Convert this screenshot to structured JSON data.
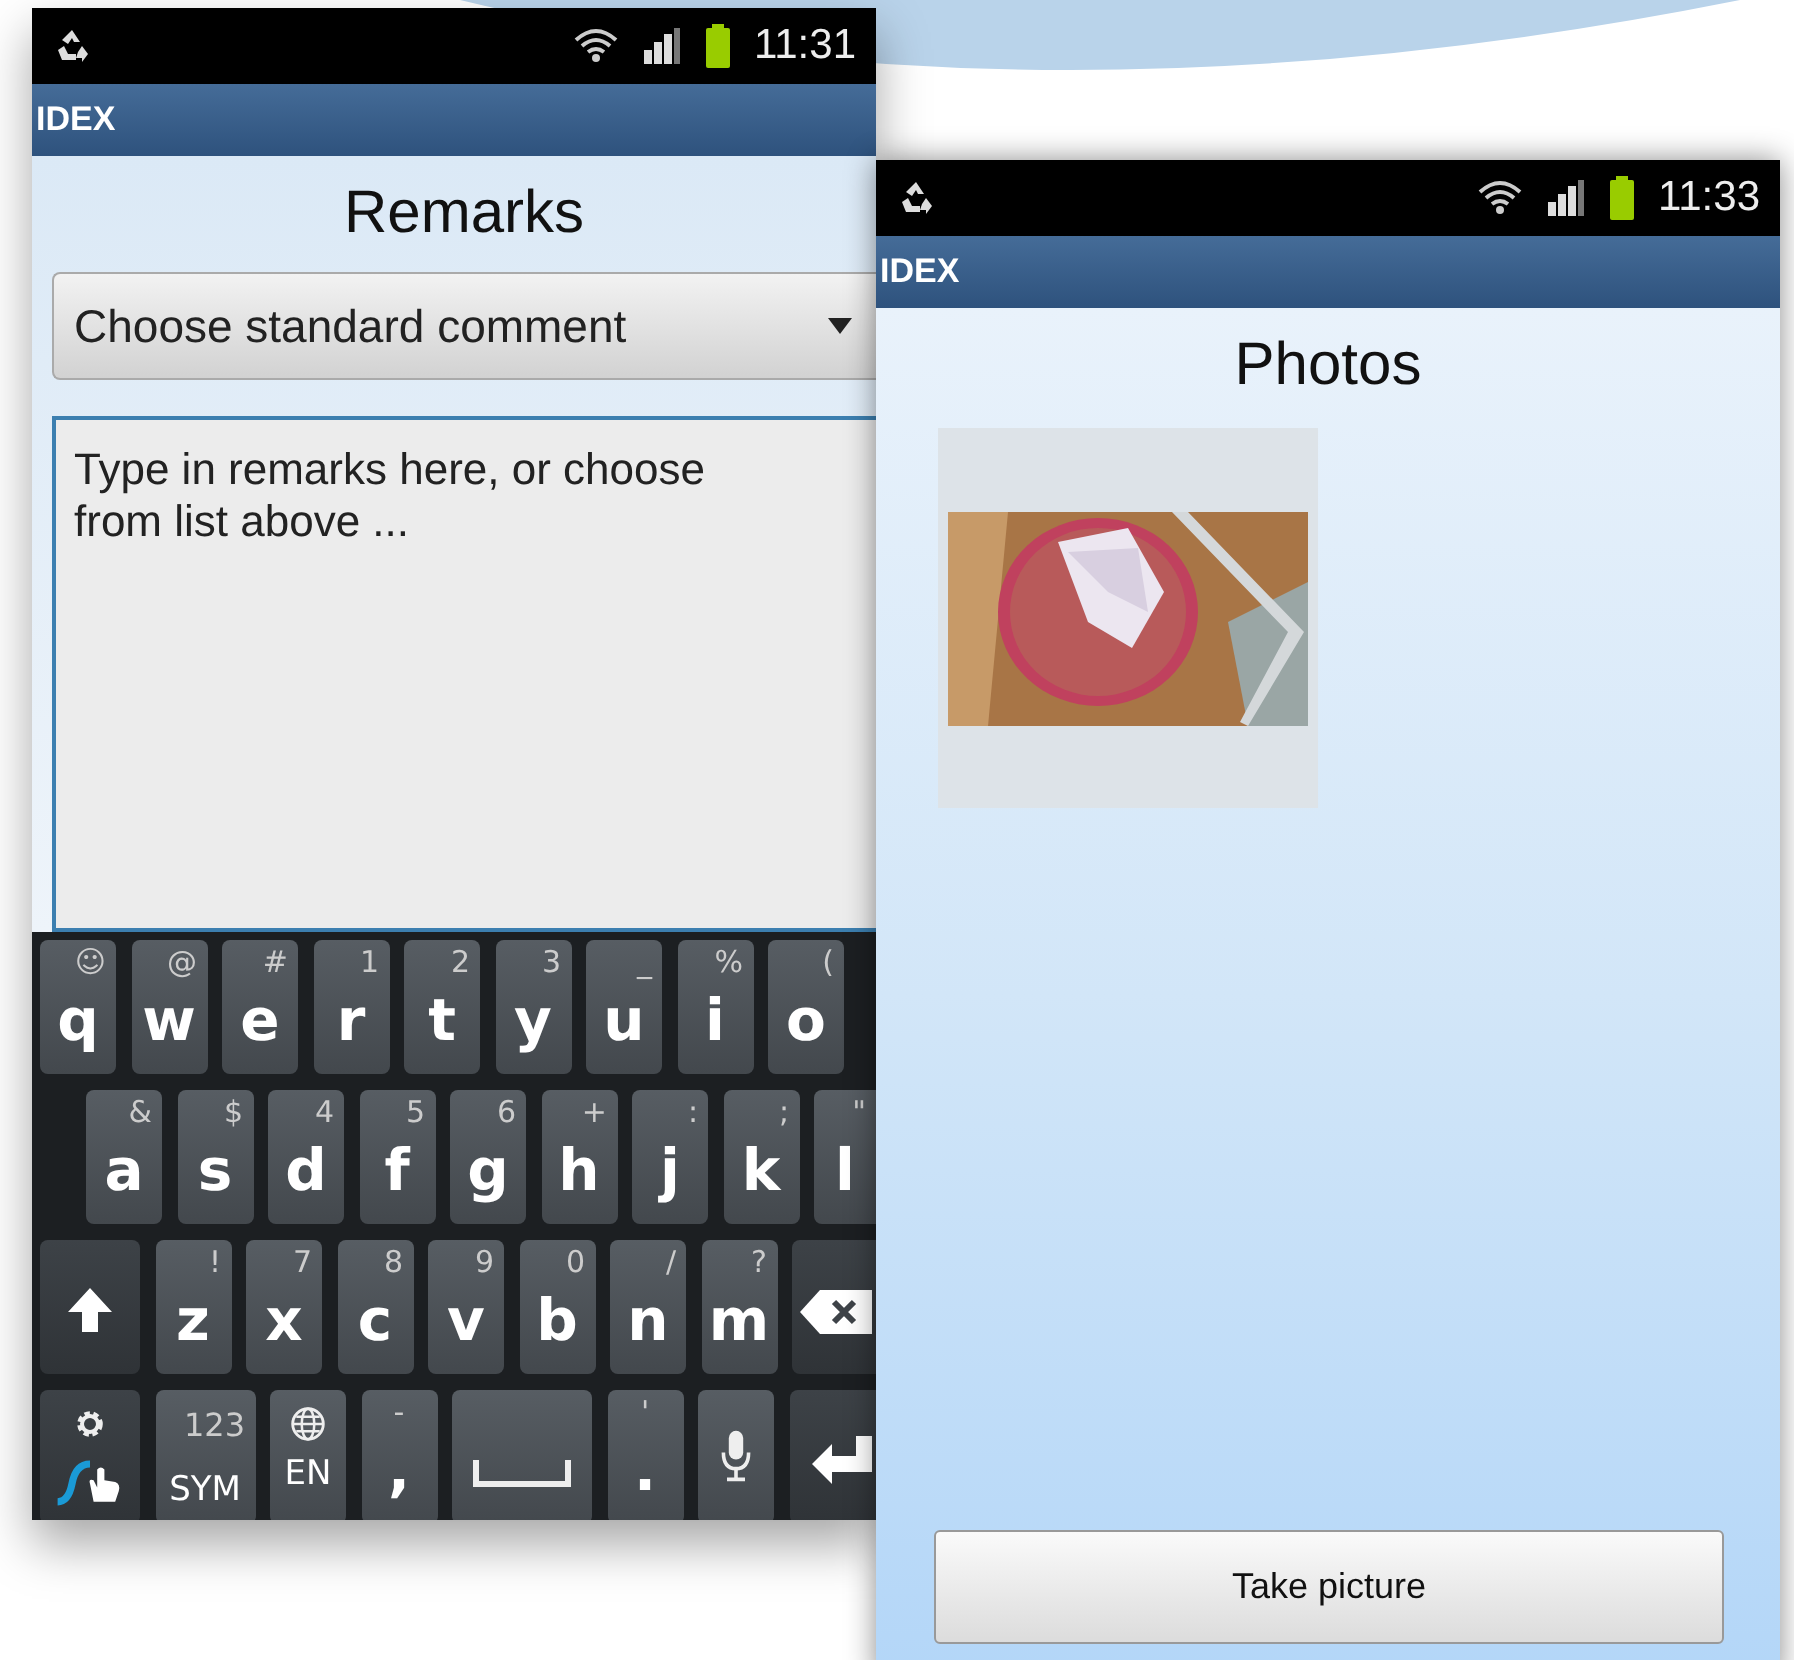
{
  "remarks_screen": {
    "status_bar": {
      "time": "11:31"
    },
    "app_bar": {
      "title": "IDEX"
    },
    "heading": "Remarks",
    "dropdown": {
      "value": "Choose standard comment"
    },
    "remarks_field": {
      "placeholder": "Type in remarks here, or choose from list above ..."
    },
    "keyboard": {
      "rows": [
        {
          "keys": [
            {
              "kind": "char",
              "hint": "☺",
              "label": "q"
            },
            {
              "kind": "char",
              "hint": "@",
              "label": "w"
            },
            {
              "kind": "char",
              "hint": "#",
              "label": "e"
            },
            {
              "kind": "char",
              "hint": "1",
              "label": "r"
            },
            {
              "kind": "char",
              "hint": "2",
              "label": "t"
            },
            {
              "kind": "char",
              "hint": "3",
              "label": "y"
            },
            {
              "kind": "char",
              "hint": "_",
              "label": "u"
            },
            {
              "kind": "char",
              "hint": "%",
              "label": "i"
            },
            {
              "kind": "char",
              "hint": "(",
              "label": "o"
            }
          ]
        },
        {
          "keys": [
            {
              "kind": "char",
              "hint": "&",
              "label": "a"
            },
            {
              "kind": "char",
              "hint": "$",
              "label": "s"
            },
            {
              "kind": "char",
              "hint": "4",
              "label": "d"
            },
            {
              "kind": "char",
              "hint": "5",
              "label": "f"
            },
            {
              "kind": "char",
              "hint": "6",
              "label": "g"
            },
            {
              "kind": "char",
              "hint": "+",
              "label": "h"
            },
            {
              "kind": "char",
              "hint": ":",
              "label": "j"
            },
            {
              "kind": "char",
              "hint": ";",
              "label": "k"
            },
            {
              "kind": "char",
              "hint": "\"",
              "label": "l"
            }
          ]
        },
        {
          "keys": [
            {
              "kind": "shift"
            },
            {
              "kind": "char",
              "hint": "!",
              "label": "z"
            },
            {
              "kind": "char",
              "hint": "7",
              "label": "x"
            },
            {
              "kind": "char",
              "hint": "8",
              "label": "c"
            },
            {
              "kind": "char",
              "hint": "9",
              "label": "v"
            },
            {
              "kind": "char",
              "hint": "0",
              "label": "b"
            },
            {
              "kind": "char",
              "hint": "/",
              "label": "n"
            },
            {
              "kind": "char",
              "hint": "?",
              "label": "m"
            },
            {
              "kind": "backspace"
            }
          ]
        },
        {
          "keys": [
            {
              "kind": "settings"
            },
            {
              "kind": "sym",
              "hint": "123",
              "label": "SYM"
            },
            {
              "kind": "lang",
              "label": "EN"
            },
            {
              "kind": "char",
              "hint": "-",
              "label": ","
            },
            {
              "kind": "space"
            },
            {
              "kind": "char",
              "hint": "'",
              "label": "."
            },
            {
              "kind": "mic"
            },
            {
              "kind": "enter"
            }
          ]
        }
      ]
    }
  },
  "photos_screen": {
    "status_bar": {
      "time": "11:33"
    },
    "app_bar": {
      "title": "IDEX"
    },
    "heading": "Photos",
    "button": "Take picture"
  }
}
